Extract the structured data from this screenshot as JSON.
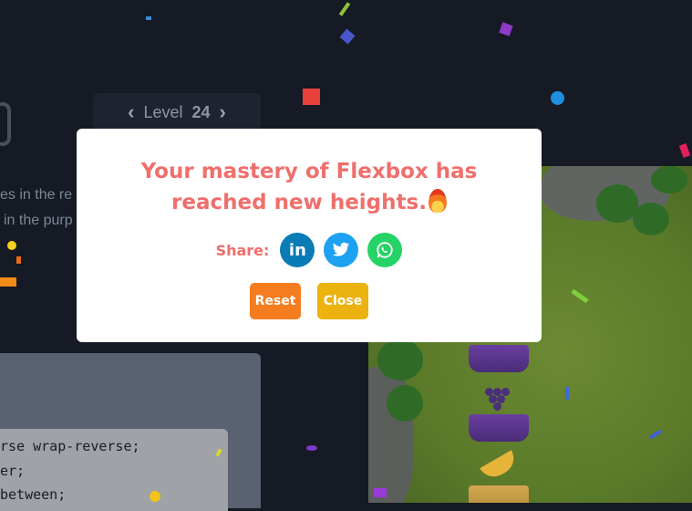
{
  "header": {
    "level_label": "Level",
    "level_number": "24",
    "prev_icon": "chevron-left-icon",
    "next_icon": "chevron-right-icon"
  },
  "instructions": {
    "line1": "es in the re",
    "line2": "in the purp"
  },
  "code": {
    "line1": "rse wrap-reverse;",
    "line2": "er;",
    "line3": "between;"
  },
  "modal": {
    "title_line1": "Your mastery of Flexbox has",
    "title_line2": "reached new heights.",
    "title_emoji": "fire-icon",
    "share_label": "Share:",
    "share_buttons": [
      {
        "icon": "linkedin-icon",
        "glyph": "in",
        "color": "#0a7bb4"
      },
      {
        "icon": "twitter-icon",
        "glyph": "🐦",
        "color": "#1da1f2"
      },
      {
        "icon": "whatsapp-icon",
        "glyph": "✆",
        "color": "#25d366"
      }
    ],
    "reset_label": "Reset",
    "close_label": "Close"
  },
  "colors": {
    "title": "#ef6f6c",
    "reset": "#f57c1f",
    "close": "#ecb20f",
    "background": "#151a24"
  }
}
